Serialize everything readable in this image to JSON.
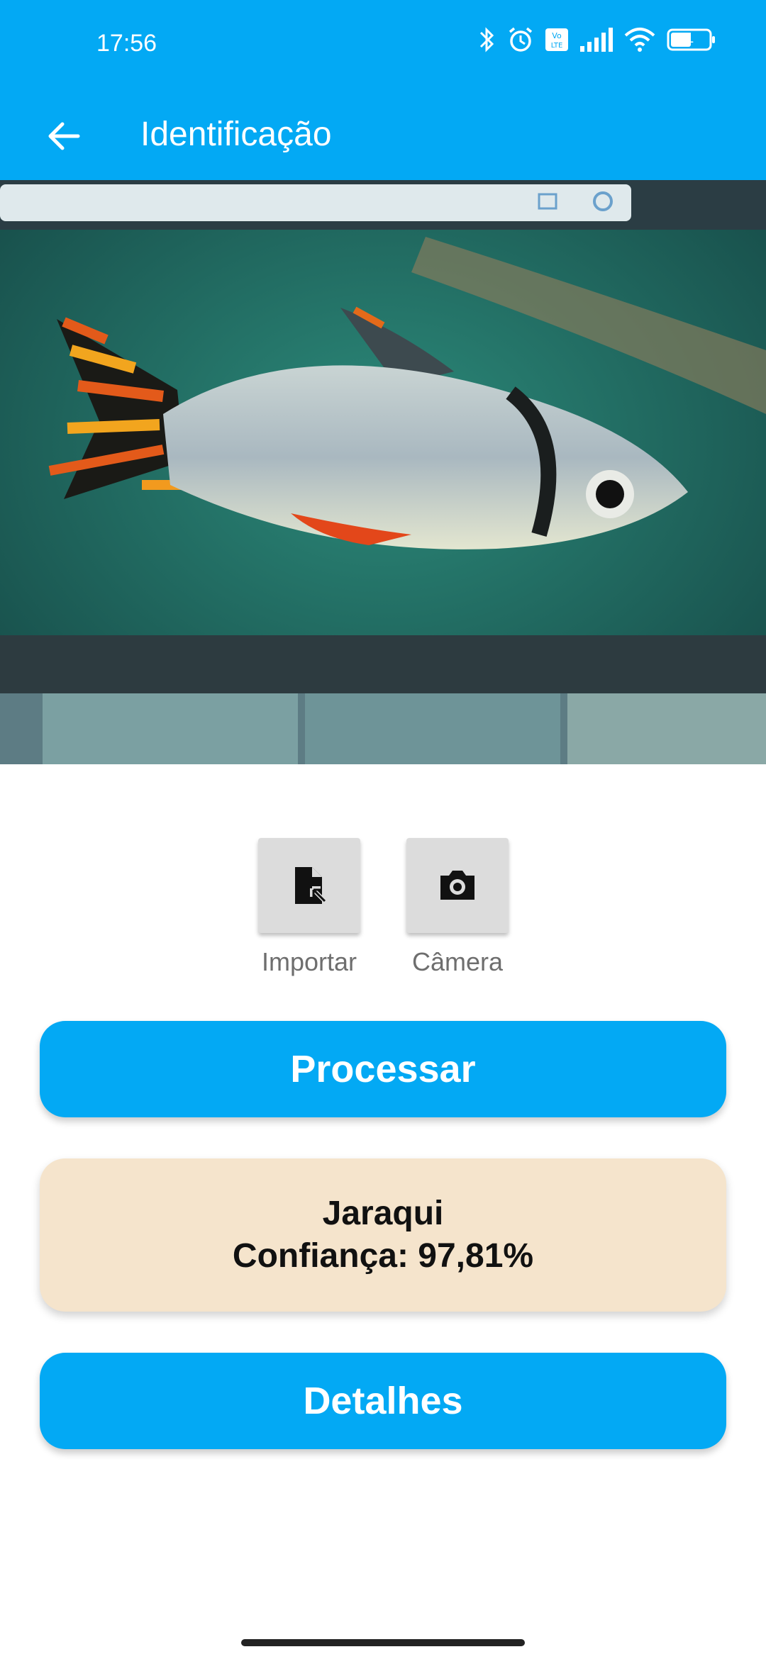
{
  "status_bar": {
    "time": "17:56",
    "battery": "51",
    "icons": [
      "bluetooth-icon",
      "alarm-icon",
      "volte-icon",
      "signal-icon",
      "wifi-icon",
      "battery-icon"
    ]
  },
  "app_bar": {
    "title": "Identificação",
    "back_icon": "arrow-back-icon",
    "color": "#03A9F4"
  },
  "photo": {
    "description_icon": "fish-photo"
  },
  "actions": {
    "import_label": "Importar",
    "camera_label": "Câmera"
  },
  "process_button": "Processar",
  "result": {
    "species": "Jaraqui",
    "confidence": "Confiança: 97,81%"
  },
  "details_button": "Detalhes",
  "colors": {
    "primary": "#03A9F4",
    "result_card": "#F5E4CC"
  }
}
